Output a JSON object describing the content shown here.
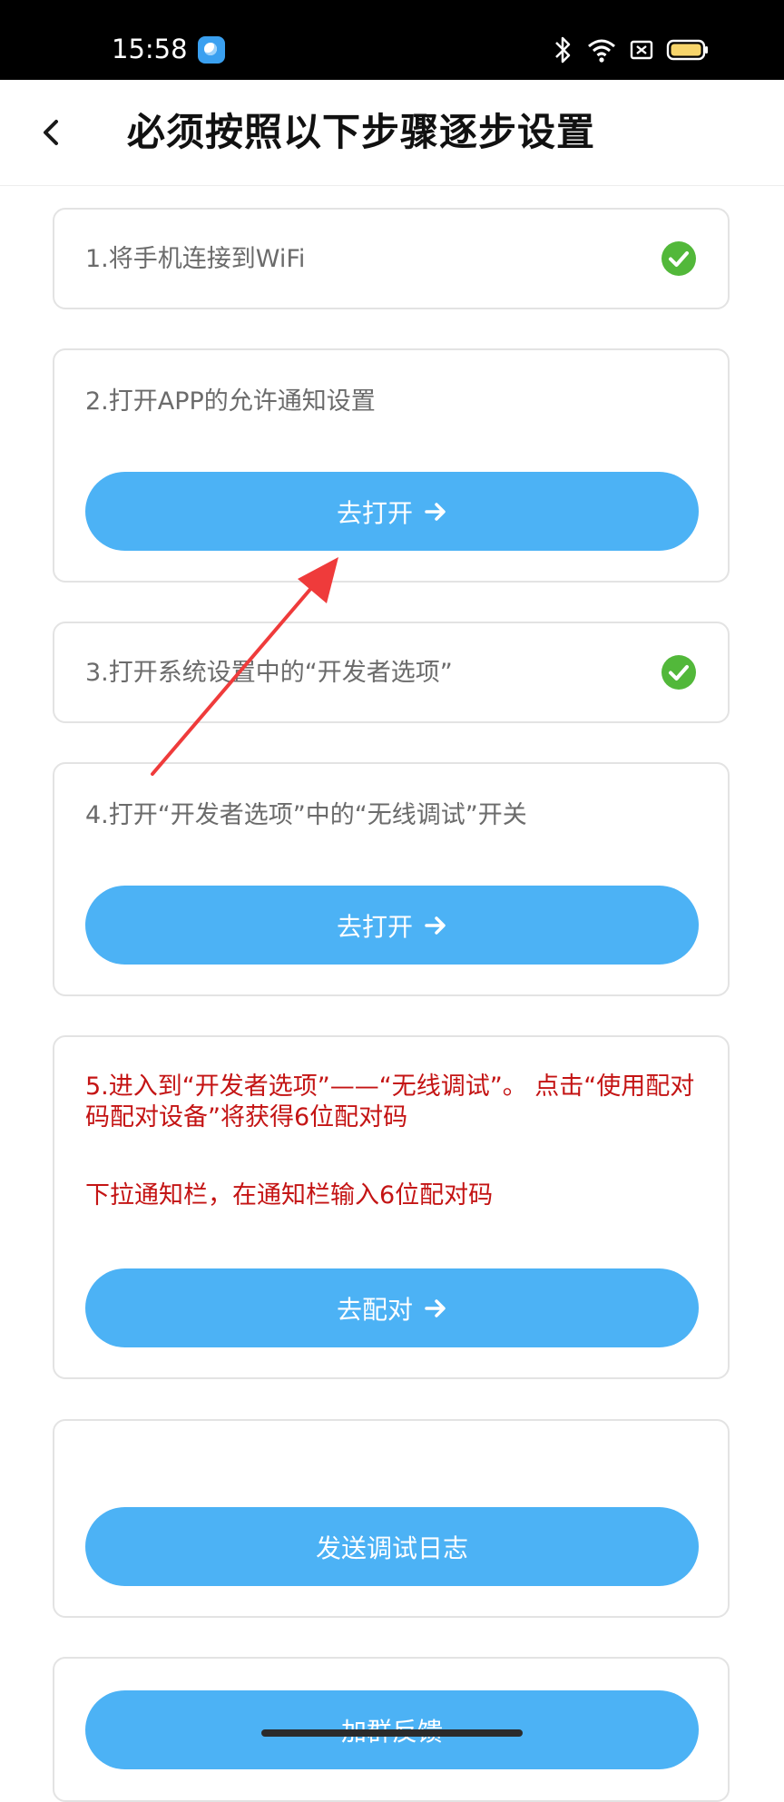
{
  "status_bar": {
    "time": "15:58",
    "icons": [
      "app-notification-icon",
      "bluetooth-icon",
      "wifi-icon",
      "sim-off-icon",
      "battery-icon"
    ]
  },
  "header": {
    "back_icon": "chevron-left-icon",
    "title": "必须按照以下步骤逐步设置"
  },
  "steps": [
    {
      "label": "1.将手机连接到WiFi",
      "done": true
    },
    {
      "label": "2.打开APP的允许通知设置",
      "button": "去打开"
    },
    {
      "label": "3.打开系统设置中的“开发者选项”",
      "done": true
    },
    {
      "label": "4.打开“开发者选项”中的“无线调试”开关",
      "button": "去打开"
    },
    {
      "label": "5.进入到“开发者选项”——“无线调试”。 点击“使用配对码配对设备”将获得6位配对码",
      "note": "下拉通知栏，在通知栏输入6位配对码",
      "button": "去配对"
    }
  ],
  "actions": {
    "send_log": "发送调试日志",
    "join_group": "加群反馈"
  },
  "colors": {
    "accent": "#4cb2f5",
    "check": "#52b83a",
    "warning_text": "#c41414",
    "annotation_arrow": "#ef3b3b"
  }
}
